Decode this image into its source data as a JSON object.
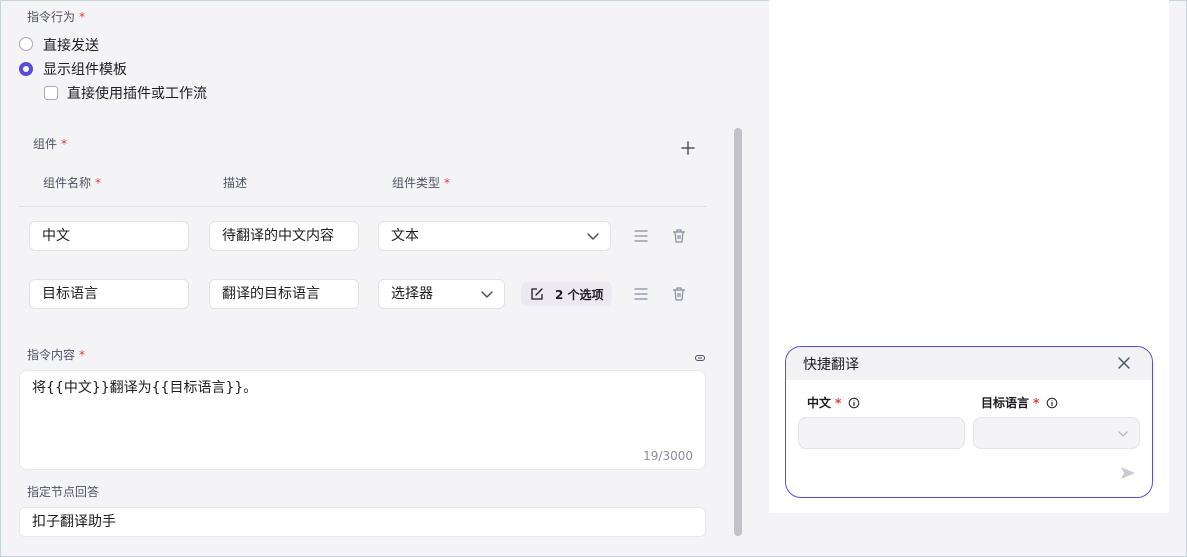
{
  "instruction_behavior": {
    "label": "指令行为",
    "required_mark": "*",
    "options": [
      {
        "label": "直接发送",
        "selected": false
      },
      {
        "label": "显示组件模板",
        "selected": true
      }
    ],
    "sub_option": {
      "label": "直接使用插件或工作流",
      "checked": false
    }
  },
  "components": {
    "label": "组件",
    "required_mark": "*",
    "columns": {
      "name": "组件名称",
      "description": "描述",
      "type": "组件类型"
    },
    "rows": [
      {
        "name": "中文",
        "description": "待翻译的中文内容",
        "type": "文本"
      },
      {
        "name": "目标语言",
        "description": "翻译的目标语言",
        "type": "选择器",
        "options_button": "2 个选项"
      }
    ]
  },
  "instruction_content": {
    "label": "指令内容",
    "required_mark": "*",
    "value": "将{{中文}}翻译为{{目标语言}}。",
    "counter": "19/3000"
  },
  "designated_node": {
    "label": "指定节点回答",
    "value": "扣子翻译助手"
  },
  "preview_card": {
    "title": "快捷翻译",
    "fields": [
      {
        "label": "中文",
        "required_mark": "*"
      },
      {
        "label": "目标语言",
        "required_mark": "*"
      }
    ]
  },
  "colors": {
    "accent": "#5a4cdb",
    "required": "#e23e3e"
  }
}
